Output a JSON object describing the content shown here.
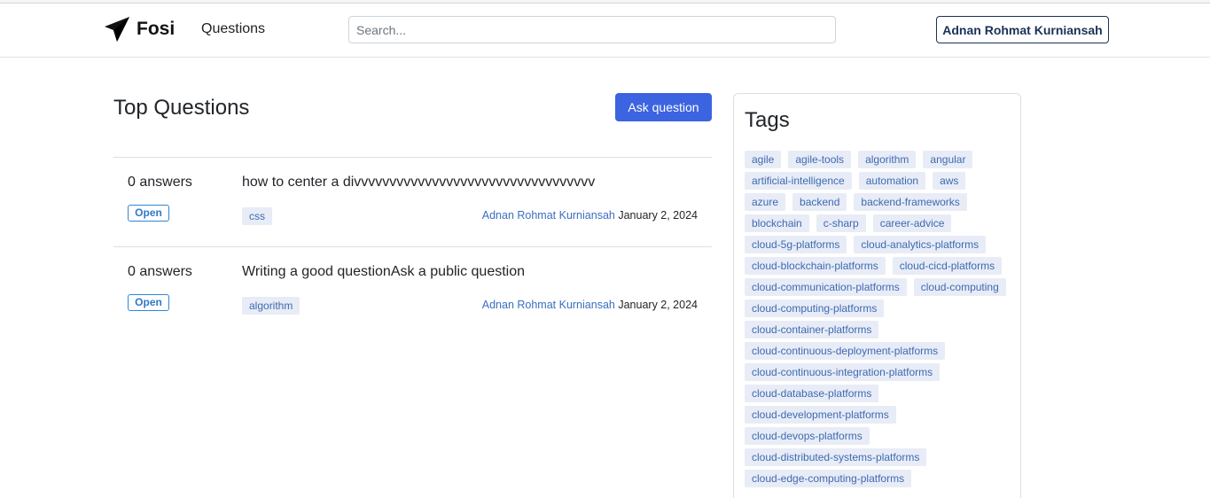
{
  "navbar": {
    "brand": "Fosi",
    "nav_link": "Questions",
    "search_placeholder": "Search...",
    "search_value": "",
    "user_button": "Adnan Rohmat Kurniansah"
  },
  "main": {
    "title": "Top Questions",
    "ask_button": "Ask question",
    "questions": [
      {
        "answers": "0 answers",
        "status": "Open",
        "title": "how to center a divvvvvvvvvvvvvvvvvvvvvvvvvvvvvvvvvv",
        "tag": "css",
        "author": "Adnan Rohmat Kurniansah",
        "date": "January 2, 2024"
      },
      {
        "answers": "0 answers",
        "status": "Open",
        "title": "Writing a good questionAsk a public question",
        "tag": "algorithm",
        "author": "Adnan Rohmat Kurniansah",
        "date": "January 2, 2024"
      }
    ]
  },
  "sidebar": {
    "title": "Tags",
    "tags": [
      "agile",
      "agile-tools",
      "algorithm",
      "angular",
      "artificial-intelligence",
      "automation",
      "aws",
      "azure",
      "backend",
      "backend-frameworks",
      "blockchain",
      "c-sharp",
      "career-advice",
      "cloud-5g-platforms",
      "cloud-analytics-platforms",
      "cloud-blockchain-platforms",
      "cloud-cicd-platforms",
      "cloud-communication-platforms",
      "cloud-computing",
      "cloud-computing-platforms",
      "cloud-container-platforms",
      "cloud-continuous-deployment-platforms",
      "cloud-continuous-integration-platforms",
      "cloud-database-platforms",
      "cloud-development-platforms",
      "cloud-devops-platforms",
      "cloud-distributed-systems-platforms",
      "cloud-edge-computing-platforms"
    ]
  }
}
